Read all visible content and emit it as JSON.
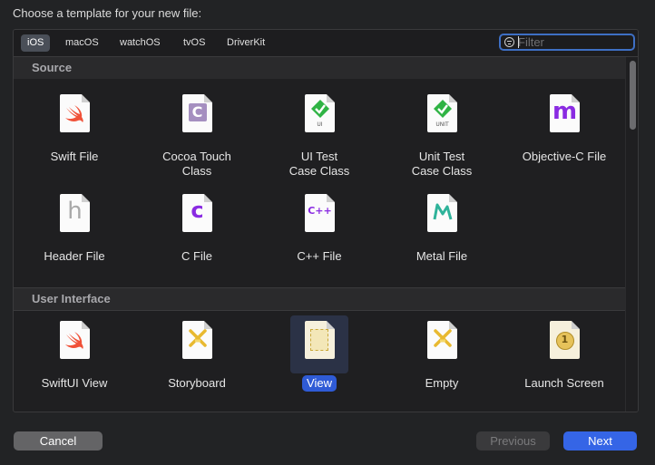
{
  "dialog": {
    "title": "Choose a template for your new file:"
  },
  "platform_tabs": [
    {
      "label": "iOS",
      "selected": true
    },
    {
      "label": "macOS"
    },
    {
      "label": "watchOS"
    },
    {
      "label": "tvOS"
    },
    {
      "label": "DriverKit"
    }
  ],
  "filter": {
    "placeholder": "Filter",
    "value": ""
  },
  "sections": [
    {
      "title": "Source",
      "items": [
        {
          "label": "Swift File",
          "icon": "swift-icon"
        },
        {
          "label": "Cocoa Touch\nClass",
          "icon": "cocoa-touch-class-icon",
          "glyph": "C"
        },
        {
          "label": "UI Test\nCase Class",
          "icon": "ui-test-icon",
          "glyph_sub": "UI"
        },
        {
          "label": "Unit Test\nCase Class",
          "icon": "unit-test-icon",
          "glyph_sub": "UNIT"
        },
        {
          "label": "Objective-C File",
          "icon": "objective-c-icon",
          "glyph": "m"
        },
        {
          "label": "Header File",
          "icon": "header-file-icon",
          "glyph": "h"
        },
        {
          "label": "C File",
          "icon": "c-file-icon",
          "glyph": "c"
        },
        {
          "label": "C++ File",
          "icon": "cpp-file-icon",
          "glyph": "C++"
        },
        {
          "label": "Metal File",
          "icon": "metal-file-icon"
        }
      ]
    },
    {
      "title": "User Interface",
      "items": [
        {
          "label": "SwiftUI View",
          "icon": "swift-icon"
        },
        {
          "label": "Storyboard",
          "icon": "storyboard-icon"
        },
        {
          "label": "View",
          "icon": "view-icon",
          "selected": true
        },
        {
          "label": "Empty",
          "icon": "empty-interface-icon"
        },
        {
          "label": "Launch Screen",
          "icon": "launch-screen-icon",
          "glyph": "1"
        }
      ]
    }
  ],
  "buttons": {
    "cancel": "Cancel",
    "previous": "Previous",
    "next": "Next"
  },
  "colors": {
    "accent": "#3565e6",
    "swift": "#f05138",
    "objc_purple": "#8a2be2",
    "test_green": "#2fb344"
  }
}
